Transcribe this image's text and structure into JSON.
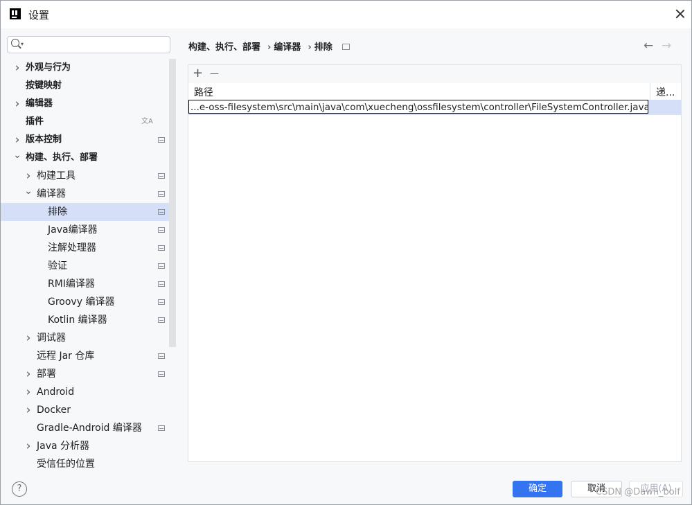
{
  "window": {
    "title": "设置"
  },
  "search": {
    "placeholder": ""
  },
  "sidebar": {
    "items": [
      {
        "label": "外观与行为",
        "level": 0,
        "expander": "right",
        "bold": true
      },
      {
        "label": "按键映射",
        "level": 0,
        "expander": "none",
        "bold": true
      },
      {
        "label": "编辑器",
        "level": 0,
        "expander": "right",
        "bold": true
      },
      {
        "label": "插件",
        "level": 0,
        "expander": "none",
        "bold": true,
        "icon": "translate-icon"
      },
      {
        "label": "版本控制",
        "level": 0,
        "expander": "right",
        "bold": true,
        "icon": "project-icon"
      },
      {
        "label": "构建、执行、部署",
        "level": 0,
        "expander": "down",
        "bold": true
      },
      {
        "label": "构建工具",
        "level": 1,
        "expander": "right",
        "icon": "project-icon"
      },
      {
        "label": "编译器",
        "level": 1,
        "expander": "down",
        "icon": "project-icon"
      },
      {
        "label": "排除",
        "level": 2,
        "expander": "none",
        "icon": "project-icon",
        "selected": true
      },
      {
        "label": "Java编译器",
        "level": 2,
        "expander": "none",
        "icon": "project-icon"
      },
      {
        "label": "注解处理器",
        "level": 2,
        "expander": "none",
        "icon": "project-icon"
      },
      {
        "label": "验证",
        "level": 2,
        "expander": "none",
        "icon": "project-icon"
      },
      {
        "label": "RMI编译器",
        "level": 2,
        "expander": "none",
        "icon": "project-icon"
      },
      {
        "label": "Groovy 编译器",
        "level": 2,
        "expander": "none",
        "icon": "project-icon"
      },
      {
        "label": "Kotlin 编译器",
        "level": 2,
        "expander": "none",
        "icon": "project-icon"
      },
      {
        "label": "调试器",
        "level": 1,
        "expander": "right"
      },
      {
        "label": "远程 Jar 仓库",
        "level": 1,
        "expander": "none",
        "icon": "project-icon"
      },
      {
        "label": "部署",
        "level": 1,
        "expander": "right",
        "icon": "project-icon"
      },
      {
        "label": "Android",
        "level": 1,
        "expander": "right"
      },
      {
        "label": "Docker",
        "level": 1,
        "expander": "right"
      },
      {
        "label": "Gradle-Android 编译器",
        "level": 1,
        "expander": "none",
        "icon": "project-icon"
      },
      {
        "label": "Java 分析器",
        "level": 1,
        "expander": "right"
      },
      {
        "label": "受信任的位置",
        "level": 1,
        "expander": "none"
      }
    ]
  },
  "breadcrumb": {
    "items": [
      "构建、执行、部署",
      "编译器",
      "排除"
    ],
    "separator": "›"
  },
  "toolbar": {
    "add_label": "+",
    "remove_label": "—"
  },
  "table": {
    "columns": [
      "路径",
      "递..."
    ],
    "rows": [
      {
        "path": "...e-oss-filesystem\\src\\main\\java\\com\\xuecheng\\ossfilesystem\\controller\\FileSystemController.java"
      }
    ]
  },
  "footer": {
    "help_label": "?",
    "ok_label": "确定",
    "cancel_label": "取消",
    "apply_label": "应用(A)"
  },
  "watermark": "CSDN @Dawn_bolf",
  "colors": {
    "accent": "#3574f0",
    "selection": "#d5e0f8"
  }
}
